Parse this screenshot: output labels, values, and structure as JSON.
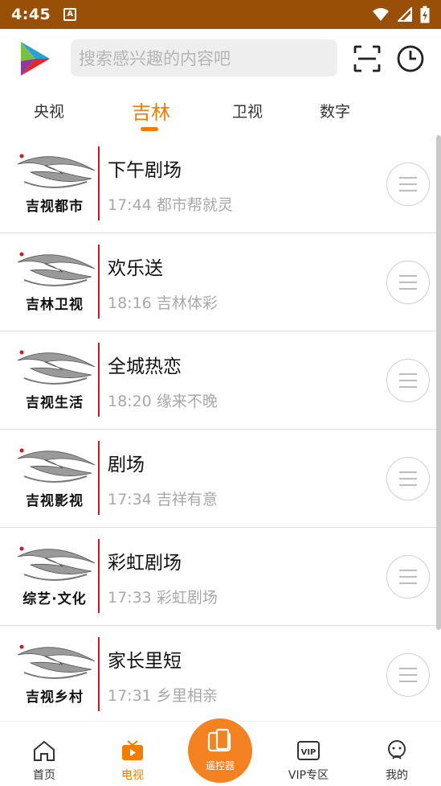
{
  "status_bar": {
    "time": "4:45",
    "notification_glyph": "A"
  },
  "search": {
    "placeholder": "搜索感兴趣的内容吧"
  },
  "tabs": [
    {
      "label": "央视",
      "active": false
    },
    {
      "label": "吉林",
      "active": true
    },
    {
      "label": "卫视",
      "active": false
    },
    {
      "label": "数字",
      "active": false
    }
  ],
  "channels": [
    {
      "logo_text": "吉视都市",
      "program": "下午剧场",
      "next_time": "17:44",
      "next_title": "都市帮就灵"
    },
    {
      "logo_text": "吉林卫视",
      "program": "欢乐送",
      "next_time": "18:16",
      "next_title": "吉林体彩"
    },
    {
      "logo_text": "吉视生活",
      "program": "全城热恋",
      "next_time": "18:20",
      "next_title": "缘来不晚"
    },
    {
      "logo_text": "吉视影视",
      "program": "剧场",
      "next_time": "17:34",
      "next_title": "吉祥有意"
    },
    {
      "logo_text": "综艺·文化",
      "program": "彩虹剧场",
      "next_time": "17:33",
      "next_title": "彩虹剧场"
    },
    {
      "logo_text": "吉视乡村",
      "program": "家长里短",
      "next_time": "17:31",
      "next_title": "乡里相亲"
    }
  ],
  "bottom_nav": {
    "home": "首页",
    "tv": "电视",
    "remote": "遥控器",
    "vip": "VIP专区",
    "vip_badge": "VIP",
    "mine": "我的"
  },
  "colors": {
    "accent": "#f07d00",
    "status_bar": "#9a4f06",
    "remote_button": "#f58220",
    "divider_red": "#c9181e"
  }
}
